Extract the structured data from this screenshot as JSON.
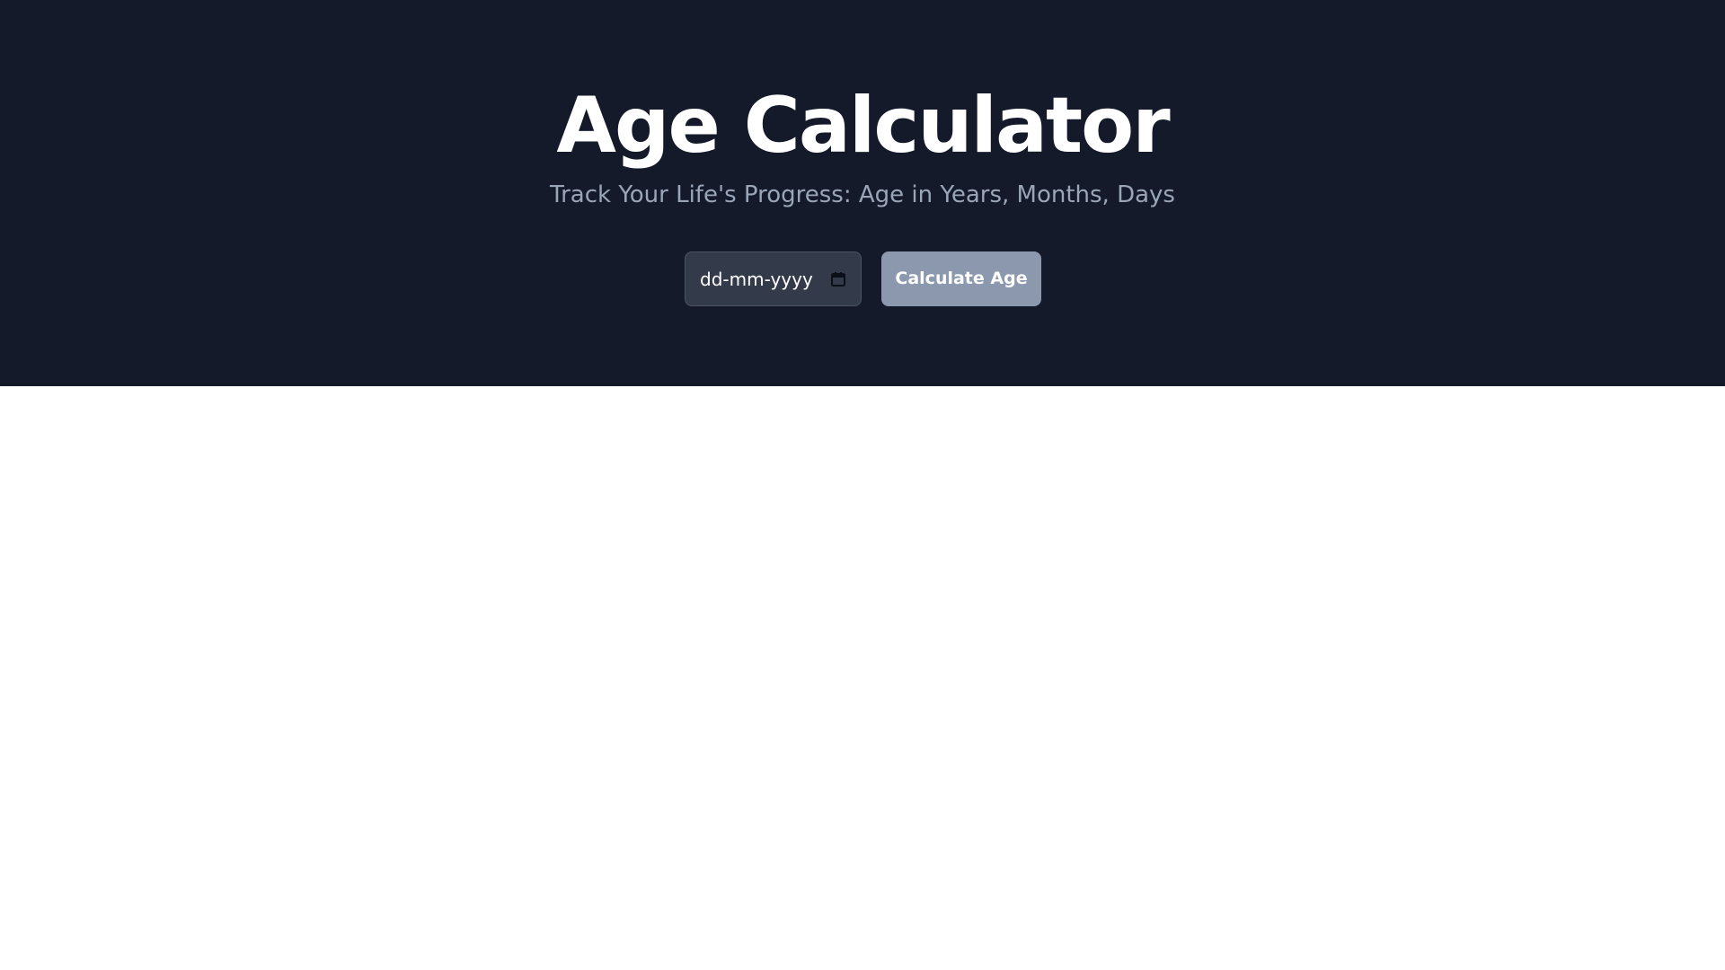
{
  "header": {
    "title": "Age Calculator",
    "subtitle": "Track Your Life's Progress: Age in Years, Months, Days"
  },
  "form": {
    "date_placeholder": "dd-mm-yyyy",
    "date_icon": "calendar-icon",
    "calculate_label": "Calculate Age"
  },
  "colors": {
    "hero_background": "#141a2a",
    "title": "#ffffff",
    "subtitle": "#9aa6b8",
    "input_background": "#333b4a",
    "button_background": "#8b98ae",
    "page_background": "#ffffff"
  }
}
